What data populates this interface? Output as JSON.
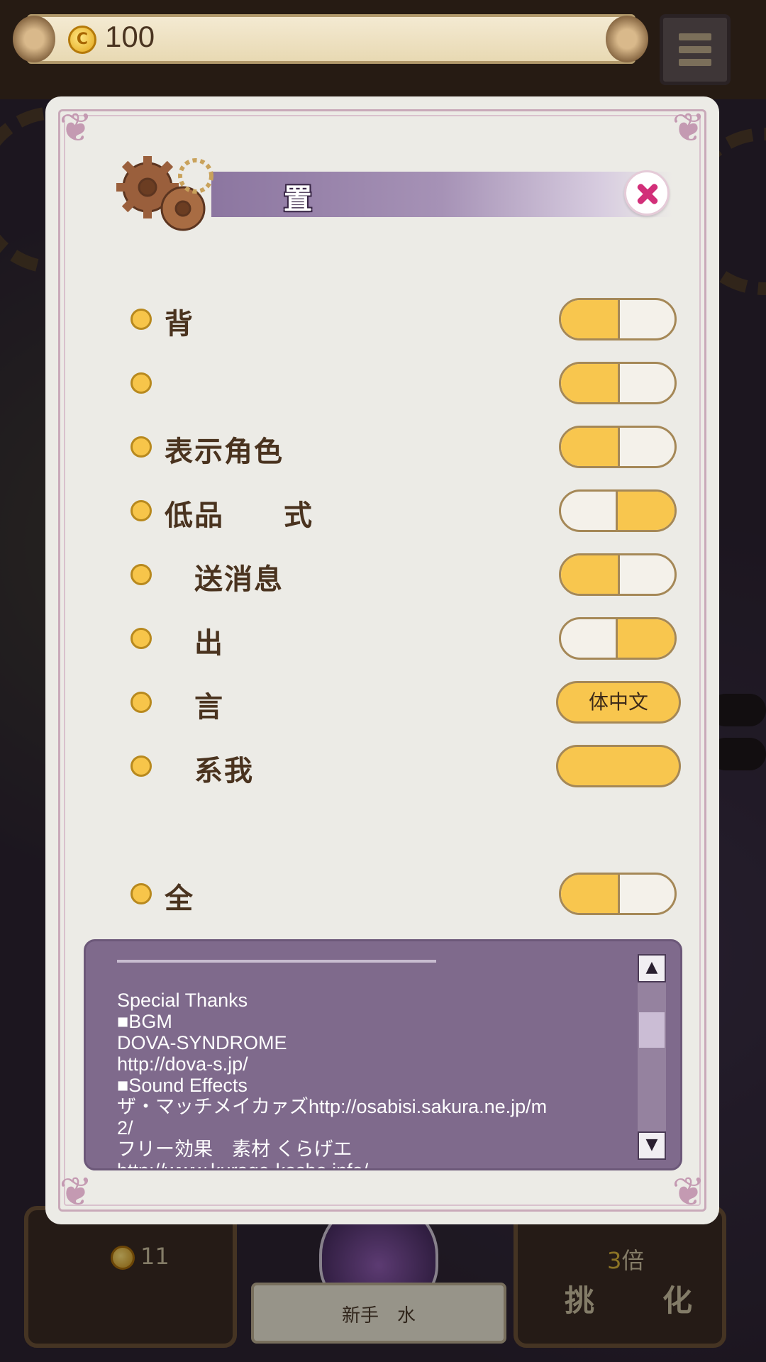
{
  "top_bar": {
    "coin_value": "100"
  },
  "dialog": {
    "title": "置",
    "settings": [
      {
        "label": "背",
        "control": "toggle",
        "state": "on"
      },
      {
        "label": "",
        "control": "toggle",
        "state": "on"
      },
      {
        "label": "表示角色",
        "control": "toggle",
        "state": "on"
      },
      {
        "label": "低品　　式",
        "control": "toggle",
        "state": "off"
      },
      {
        "label": "　送消息",
        "control": "toggle",
        "state": "on"
      },
      {
        "label": "　出",
        "control": "toggle",
        "state": "off"
      },
      {
        "label": "　言",
        "control": "button",
        "value": "体中文"
      },
      {
        "label": "　系我",
        "control": "button",
        "value": ""
      },
      {
        "label": "全",
        "control": "toggle",
        "state": "on"
      }
    ],
    "credits_text": "Special Thanks\n■BGM\nDOVA-SYNDROME\nhttp://dova-s.jp/\n■Sound Effects\nザ・マッチメイカァズhttp://osabisi.sakura.ne.jp/m\n2/\nフリー効果　素材 くらげエ\nhttp://www.kurage-kosho.info/"
  },
  "background": {
    "left_panel_coin": "11",
    "right_panel_multiplier": "3",
    "right_panel_multiplier_suffix": "倍",
    "right_panel_title": "挑　　化",
    "bottom_label": "新手　水"
  },
  "colors": {
    "toggle_fill": "#f8c64e",
    "banner_purple": "#8c76a0",
    "close_x": "#d22f79",
    "credits_bg": "#7f6a8c"
  }
}
